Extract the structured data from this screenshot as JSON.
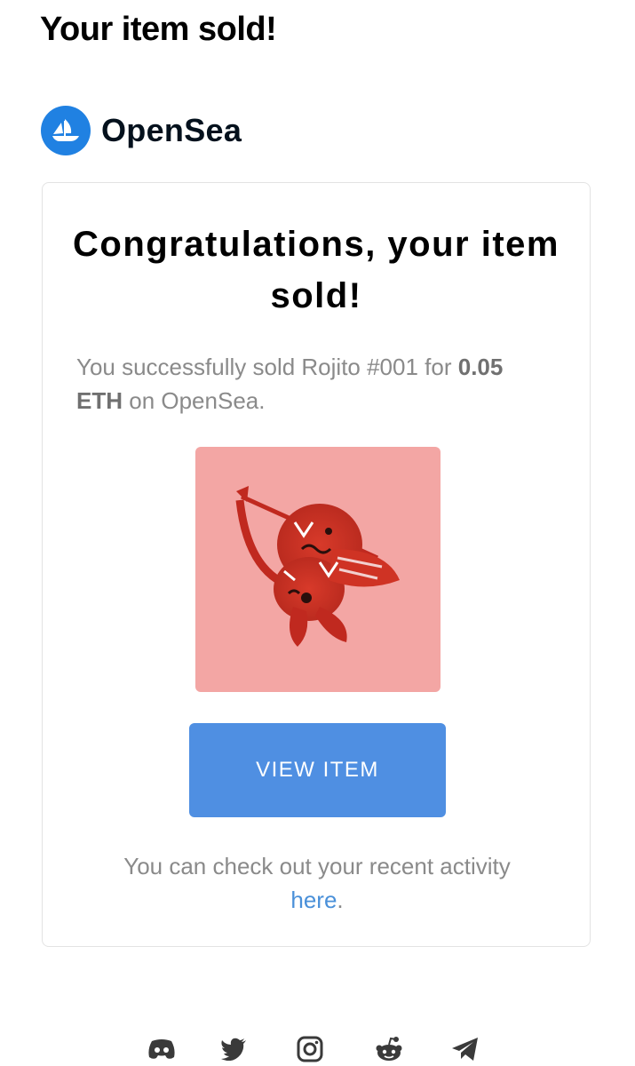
{
  "email": {
    "subject": "Your item sold!"
  },
  "brand": {
    "name": "OpenSea",
    "color": "#2081e2",
    "icon": "opensea-ship-icon"
  },
  "card": {
    "title": "Congratulations, your item sold!",
    "message_prefix": "You successfully sold Rojito #001 for",
    "price": "0.05 ETH",
    "message_suffix": "on OpenSea.",
    "item_image": "rojito-cupid-nft-image",
    "button_label": "VIEW ITEM",
    "button_color": "#4f8fe2",
    "activity_text": "You can check out your recent activity",
    "activity_link": "here",
    "activity_end": "."
  },
  "footer": {
    "social_icons": [
      "discord-icon",
      "twitter-icon",
      "instagram-icon",
      "reddit-icon",
      "telegram-icon"
    ]
  }
}
